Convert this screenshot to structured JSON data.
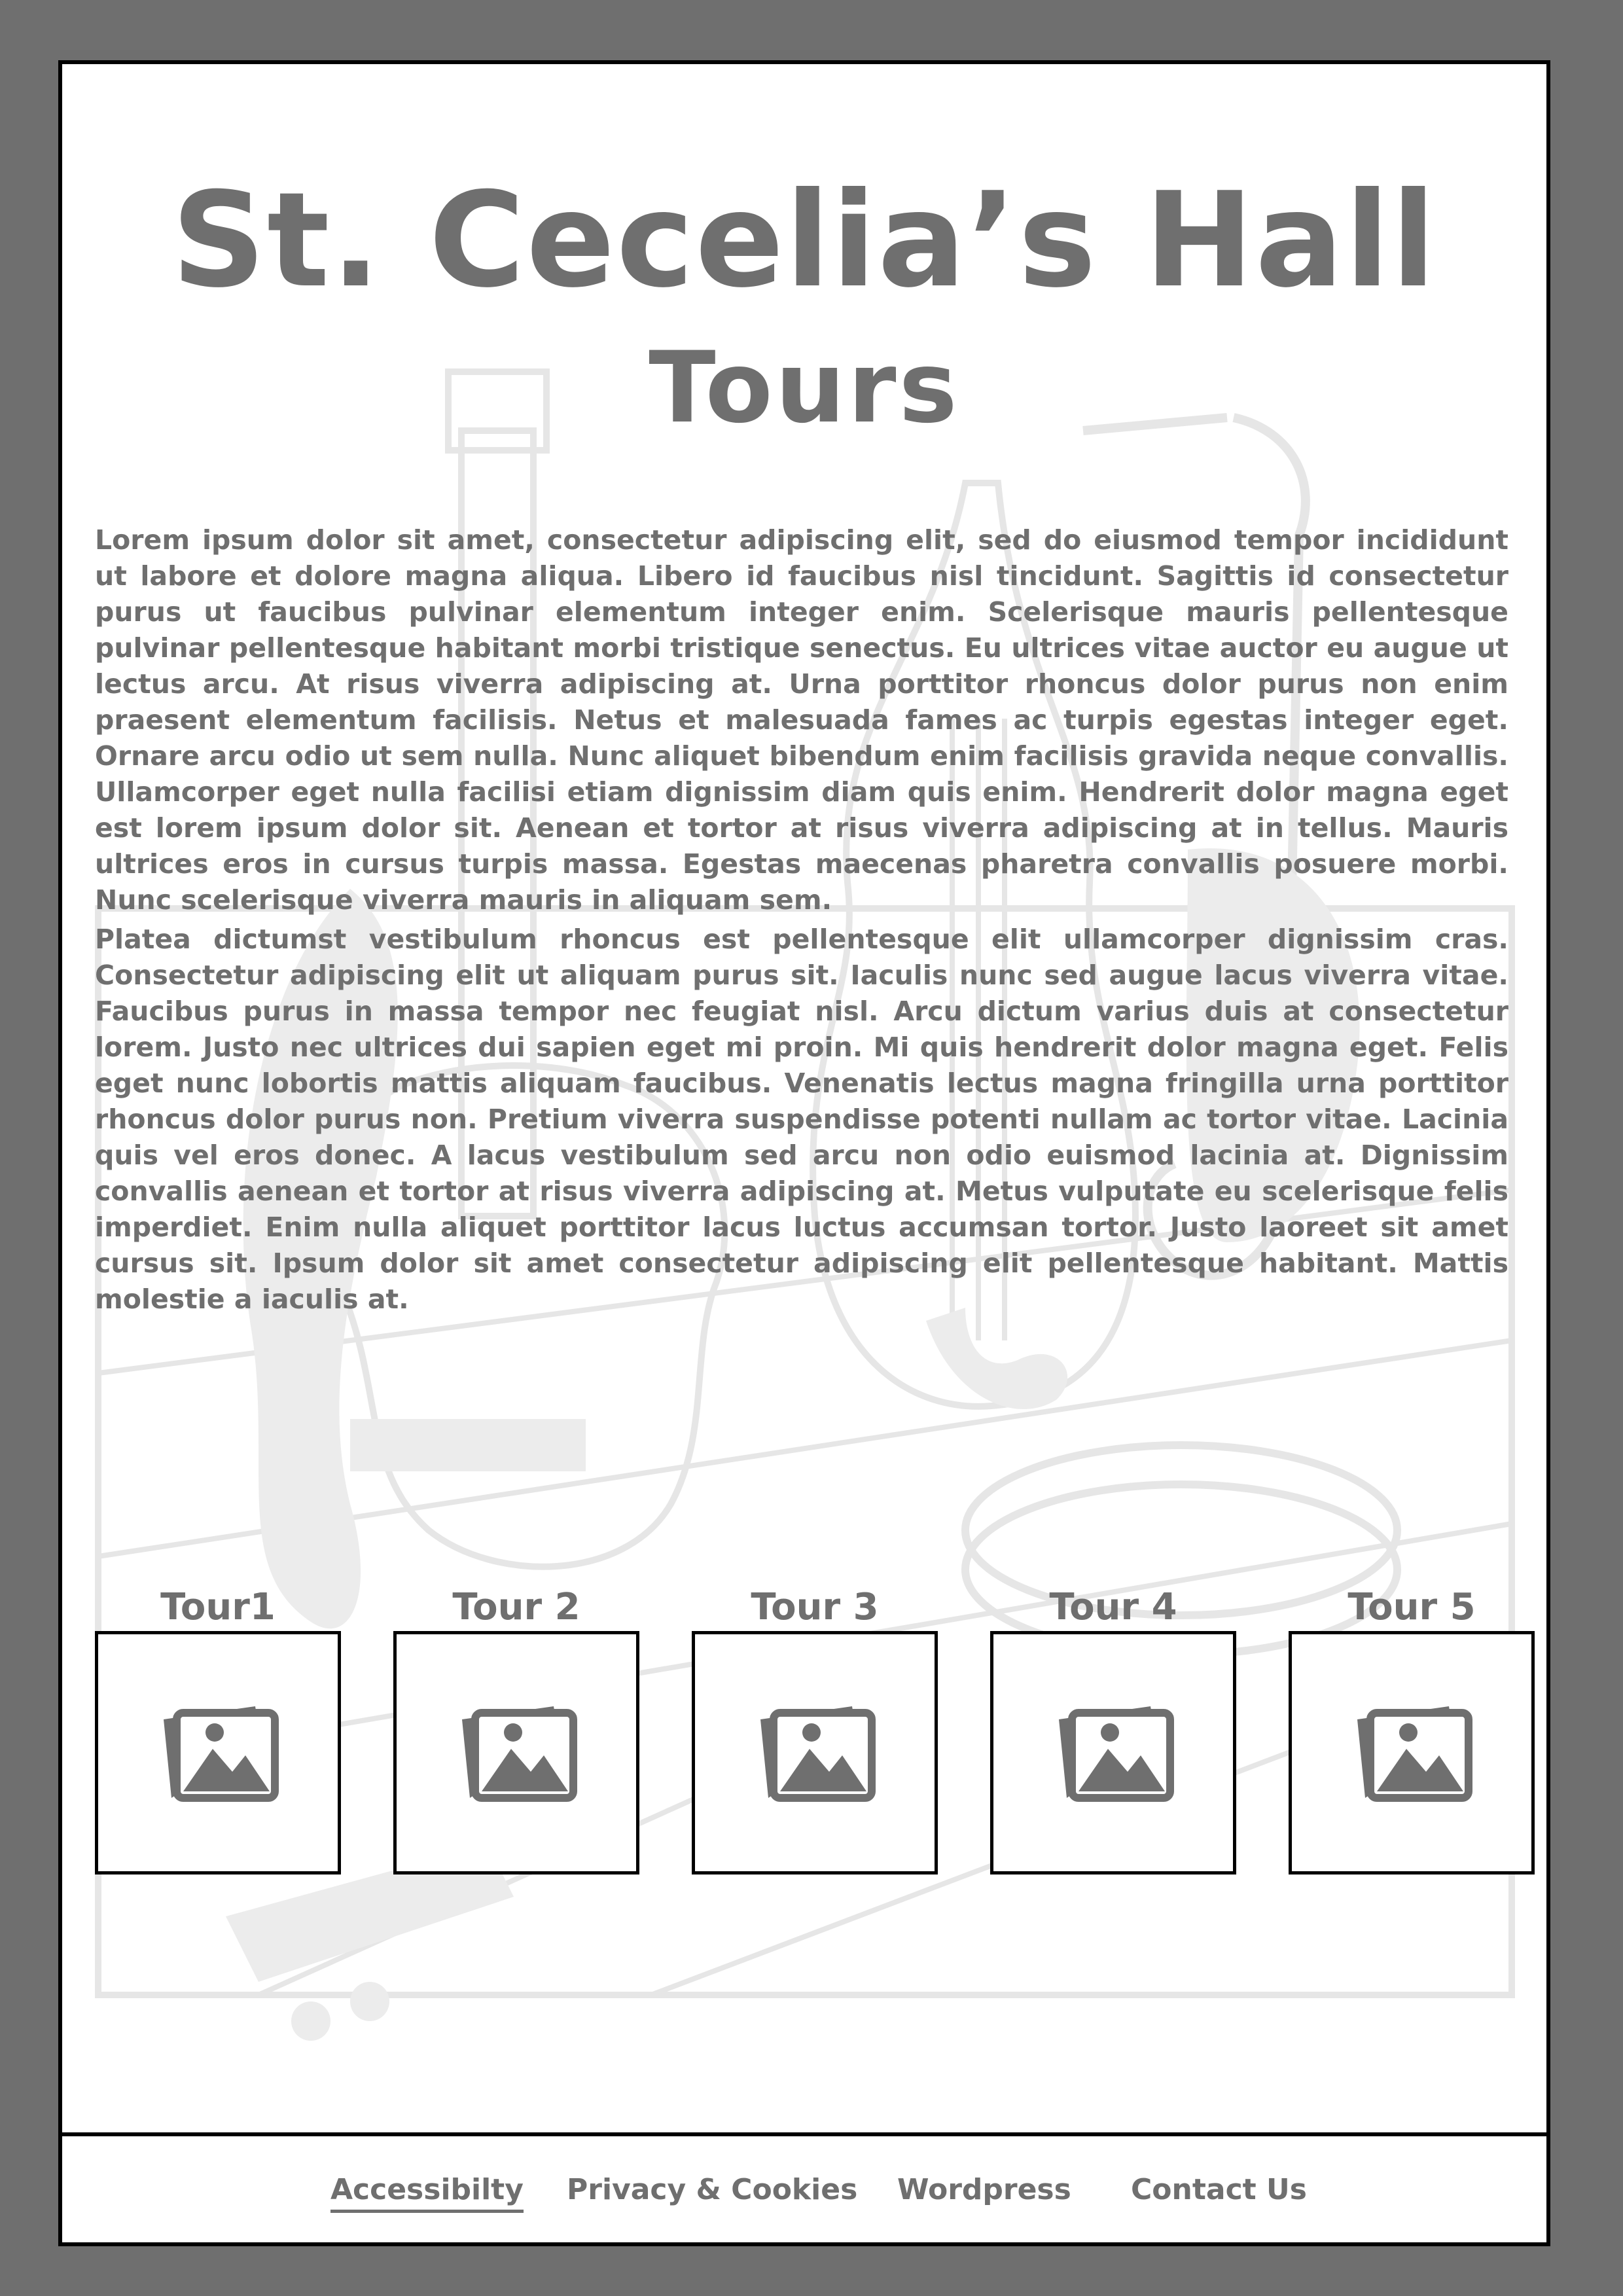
{
  "header": {
    "title": "St. Cecelia’s Hall",
    "subtitle": "Tours"
  },
  "intro": {
    "paragraphs": [
      "Lorem ipsum dolor sit amet, consectetur adipiscing elit, sed do eiusmod tempor incididunt ut labore et dolore magna aliqua. Libero id faucibus nisl tincidunt. Sagittis id consectetur purus ut faucibus pulvinar elementum integer enim. Scelerisque mauris pellentesque pulvinar pellentesque habitant morbi tristique senectus. Eu ultrices vitae auctor eu augue ut lectus arcu. At risus viverra adipiscing at. Urna porttitor rhoncus dolor purus non enim praesent elementum facilisis. Netus et malesuada fames ac turpis egestas integer eget. Ornare arcu odio ut sem nulla. Nunc aliquet bibendum enim facilisis gravida neque convallis. Ullamcorper eget nulla facilisi etiam dignissim diam quis enim. Hendrerit dolor magna eget est lorem ipsum dolor sit. Aenean et tortor at risus viverra adipiscing at in tellus. Mauris ultrices eros in cursus turpis massa. Egestas maecenas pharetra convallis posuere morbi. Nunc scelerisque viverra mauris in aliquam sem.",
      "Platea dictumst vestibulum rhoncus est pellentesque elit ullamcorper dignissim cras. Consectetur adipiscing elit ut aliquam purus sit. Iaculis nunc sed augue lacus viverra vitae. Faucibus purus in massa tempor nec feugiat nisl. Arcu dictum varius duis at consectetur lorem. Justo nec ultrices dui sapien eget mi proin. Mi quis hendrerit dolor magna eget. Felis eget nunc lobortis mattis aliquam faucibus. Venenatis lectus magna fringilla urna porttitor rhoncus dolor purus non. Pretium viverra suspendisse potenti nullam ac tortor vitae. Lacinia quis vel eros donec. A lacus vestibulum sed arcu non odio euismod lacinia at. Dignissim convallis aenean et tortor at risus viverra adipiscing at. Metus vulputate eu scelerisque felis imperdiet. Enim nulla aliquet porttitor lacus luctus accumsan tortor. Justo laoreet sit amet cursus sit. Ipsum dolor sit amet consectetur adipiscing elit pellentesque habitant. Mattis molestie a iaculis at."
    ]
  },
  "tours": [
    {
      "label": "Tour1",
      "icon": "image-placeholder-icon"
    },
    {
      "label": "Tour 2",
      "icon": "image-placeholder-icon"
    },
    {
      "label": "Tour 3",
      "icon": "image-placeholder-icon"
    },
    {
      "label": "Tour 4",
      "icon": "image-placeholder-icon"
    },
    {
      "label": "Tour 5",
      "icon": "image-placeholder-icon"
    }
  ],
  "footer": {
    "links": [
      {
        "label": "Accessibilty",
        "active": true
      },
      {
        "label": "Privacy & Cookies",
        "active": false
      },
      {
        "label": "Wordpress",
        "active": false
      },
      {
        "label": "Contact Us",
        "active": false
      }
    ]
  },
  "colors": {
    "frame_background": "#6f6f6f",
    "text": "#6f6f6f",
    "page_background": "#ffffff",
    "border": "#000000",
    "watermark": "#e8e8e8"
  }
}
